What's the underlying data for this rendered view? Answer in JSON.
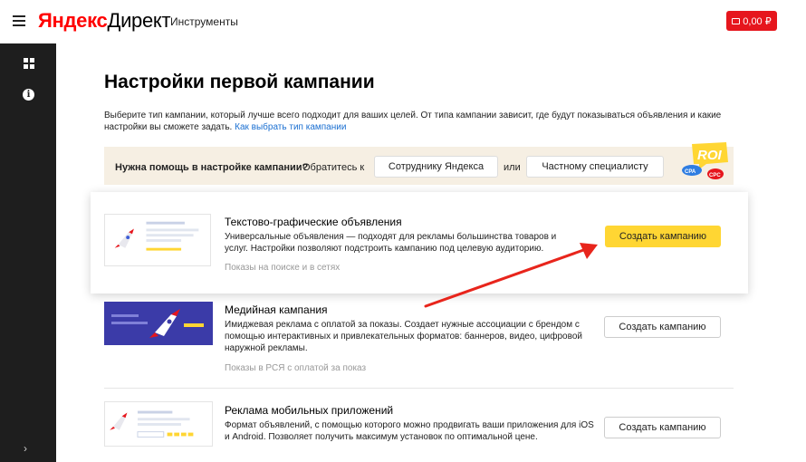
{
  "header": {
    "logo_part1": "Яндекс",
    "logo_part2": "Директ",
    "tools_label": "Инструменты",
    "balance": "0,00 ₽"
  },
  "page": {
    "title": "Настройки первой кампании",
    "intro_text": "Выберите тип кампании, который лучше всего подходит для ваших целей. От типа кампании зависит, где будут показываться объявления и какие настройки вы сможете задать. ",
    "intro_link": "Как выбрать тип кампании"
  },
  "help": {
    "question": "Нужна помощь в настройке кампании?",
    "text1": "Обратитесь к",
    "button1": "Сотруднику Яндекса",
    "text2": "или",
    "button2": "Частному специалисту",
    "badge_roi": "ROI",
    "badge_cpa": "CPA",
    "badge_cpc": "CPC"
  },
  "campaigns": [
    {
      "title": "Текстово-графические объявления",
      "description": "Универсальные объявления — подходят для рекламы большинства товаров и услуг. Настройки позволяют подстроить кампанию под целевую аудиторию.",
      "note": "Показы на поиске и в сетях",
      "button": "Создать кампанию"
    },
    {
      "title": "Медийная кампания",
      "description": "Имиджевая реклама с оплатой за показы. Создает нужные ассоциации с брендом с помощью интерактивных и привлекательных форматов: баннеров, видео, цифровой наружной рекламы.",
      "note": "Показы в РСЯ с оплатой за показ",
      "button": "Создать кампанию"
    },
    {
      "title": "Реклама мобильных приложений",
      "description": "Формат объявлений, с помощью которого можно продвигать ваши приложения для iOS и Android. Позволяет получить максимум установок по оптимальной цене.",
      "button": "Создать кампанию"
    }
  ],
  "colors": {
    "brand_red": "#e6161d",
    "accent_yellow": "#ffd633",
    "link_blue": "#1a6fd1",
    "sidebar": "#1e1e1e",
    "help_bg": "#f6efe3",
    "arrow": "#e8251c"
  },
  "icons": {
    "menu": "menu-icon",
    "wallet": "wallet-icon",
    "dashboard": "dashboard-grid-icon",
    "info": "info-icon",
    "collapse": "chevron-right-icon",
    "rocket": "rocket-icon"
  }
}
